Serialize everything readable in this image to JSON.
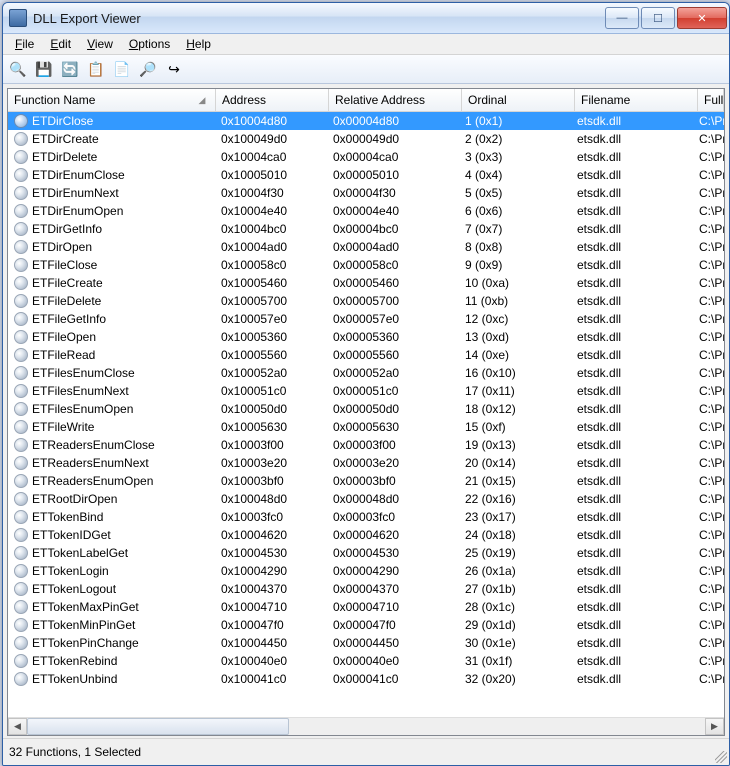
{
  "window": {
    "title": "DLL Export Viewer"
  },
  "menu": {
    "file": "File",
    "edit": "Edit",
    "view": "View",
    "options": "Options",
    "help": "Help"
  },
  "toolbar_icons": {
    "find": "🔍",
    "save": "💾",
    "refresh": "🔄",
    "copy": "📋",
    "props": "📄",
    "html_report": "🔎",
    "exit": "↪"
  },
  "columns": {
    "function_name": "Function Name",
    "address": "Address",
    "relative_address": "Relative Address",
    "ordinal": "Ordinal",
    "filename": "Filename",
    "full_path": "Full Path"
  },
  "status": "32 Functions, 1 Selected",
  "rows": [
    {
      "fn": "ETDirClose",
      "ad": "0x10004d80",
      "ra": "0x00004d80",
      "or": "1 (0x1)",
      "fi": "etsdk.dll",
      "fp": "C:\\Program Files",
      "sel": true
    },
    {
      "fn": "ETDirCreate",
      "ad": "0x100049d0",
      "ra": "0x000049d0",
      "or": "2 (0x2)",
      "fi": "etsdk.dll",
      "fp": "C:\\Program Files"
    },
    {
      "fn": "ETDirDelete",
      "ad": "0x10004ca0",
      "ra": "0x00004ca0",
      "or": "3 (0x3)",
      "fi": "etsdk.dll",
      "fp": "C:\\Program Files"
    },
    {
      "fn": "ETDirEnumClose",
      "ad": "0x10005010",
      "ra": "0x00005010",
      "or": "4 (0x4)",
      "fi": "etsdk.dll",
      "fp": "C:\\Program Files"
    },
    {
      "fn": "ETDirEnumNext",
      "ad": "0x10004f30",
      "ra": "0x00004f30",
      "or": "5 (0x5)",
      "fi": "etsdk.dll",
      "fp": "C:\\Program Files"
    },
    {
      "fn": "ETDirEnumOpen",
      "ad": "0x10004e40",
      "ra": "0x00004e40",
      "or": "6 (0x6)",
      "fi": "etsdk.dll",
      "fp": "C:\\Program Files"
    },
    {
      "fn": "ETDirGetInfo",
      "ad": "0x10004bc0",
      "ra": "0x00004bc0",
      "or": "7 (0x7)",
      "fi": "etsdk.dll",
      "fp": "C:\\Program Files"
    },
    {
      "fn": "ETDirOpen",
      "ad": "0x10004ad0",
      "ra": "0x00004ad0",
      "or": "8 (0x8)",
      "fi": "etsdk.dll",
      "fp": "C:\\Program Files"
    },
    {
      "fn": "ETFileClose",
      "ad": "0x100058c0",
      "ra": "0x000058c0",
      "or": "9 (0x9)",
      "fi": "etsdk.dll",
      "fp": "C:\\Program Files"
    },
    {
      "fn": "ETFileCreate",
      "ad": "0x10005460",
      "ra": "0x00005460",
      "or": "10 (0xa)",
      "fi": "etsdk.dll",
      "fp": "C:\\Program Files"
    },
    {
      "fn": "ETFileDelete",
      "ad": "0x10005700",
      "ra": "0x00005700",
      "or": "11 (0xb)",
      "fi": "etsdk.dll",
      "fp": "C:\\Program Files"
    },
    {
      "fn": "ETFileGetInfo",
      "ad": "0x100057e0",
      "ra": "0x000057e0",
      "or": "12 (0xc)",
      "fi": "etsdk.dll",
      "fp": "C:\\Program Files"
    },
    {
      "fn": "ETFileOpen",
      "ad": "0x10005360",
      "ra": "0x00005360",
      "or": "13 (0xd)",
      "fi": "etsdk.dll",
      "fp": "C:\\Program Files"
    },
    {
      "fn": "ETFileRead",
      "ad": "0x10005560",
      "ra": "0x00005560",
      "or": "14 (0xe)",
      "fi": "etsdk.dll",
      "fp": "C:\\Program Files"
    },
    {
      "fn": "ETFilesEnumClose",
      "ad": "0x100052a0",
      "ra": "0x000052a0",
      "or": "16 (0x10)",
      "fi": "etsdk.dll",
      "fp": "C:\\Program Files"
    },
    {
      "fn": "ETFilesEnumNext",
      "ad": "0x100051c0",
      "ra": "0x000051c0",
      "or": "17 (0x11)",
      "fi": "etsdk.dll",
      "fp": "C:\\Program Files"
    },
    {
      "fn": "ETFilesEnumOpen",
      "ad": "0x100050d0",
      "ra": "0x000050d0",
      "or": "18 (0x12)",
      "fi": "etsdk.dll",
      "fp": "C:\\Program Files"
    },
    {
      "fn": "ETFileWrite",
      "ad": "0x10005630",
      "ra": "0x00005630",
      "or": "15 (0xf)",
      "fi": "etsdk.dll",
      "fp": "C:\\Program Files"
    },
    {
      "fn": "ETReadersEnumClose",
      "ad": "0x10003f00",
      "ra": "0x00003f00",
      "or": "19 (0x13)",
      "fi": "etsdk.dll",
      "fp": "C:\\Program Files"
    },
    {
      "fn": "ETReadersEnumNext",
      "ad": "0x10003e20",
      "ra": "0x00003e20",
      "or": "20 (0x14)",
      "fi": "etsdk.dll",
      "fp": "C:\\Program Files"
    },
    {
      "fn": "ETReadersEnumOpen",
      "ad": "0x10003bf0",
      "ra": "0x00003bf0",
      "or": "21 (0x15)",
      "fi": "etsdk.dll",
      "fp": "C:\\Program Files"
    },
    {
      "fn": "ETRootDirOpen",
      "ad": "0x100048d0",
      "ra": "0x000048d0",
      "or": "22 (0x16)",
      "fi": "etsdk.dll",
      "fp": "C:\\Program Files"
    },
    {
      "fn": "ETTokenBind",
      "ad": "0x10003fc0",
      "ra": "0x00003fc0",
      "or": "23 (0x17)",
      "fi": "etsdk.dll",
      "fp": "C:\\Program Files"
    },
    {
      "fn": "ETTokenIDGet",
      "ad": "0x10004620",
      "ra": "0x00004620",
      "or": "24 (0x18)",
      "fi": "etsdk.dll",
      "fp": "C:\\Program Files"
    },
    {
      "fn": "ETTokenLabelGet",
      "ad": "0x10004530",
      "ra": "0x00004530",
      "or": "25 (0x19)",
      "fi": "etsdk.dll",
      "fp": "C:\\Program Files"
    },
    {
      "fn": "ETTokenLogin",
      "ad": "0x10004290",
      "ra": "0x00004290",
      "or": "26 (0x1a)",
      "fi": "etsdk.dll",
      "fp": "C:\\Program Files"
    },
    {
      "fn": "ETTokenLogout",
      "ad": "0x10004370",
      "ra": "0x00004370",
      "or": "27 (0x1b)",
      "fi": "etsdk.dll",
      "fp": "C:\\Program Files"
    },
    {
      "fn": "ETTokenMaxPinGet",
      "ad": "0x10004710",
      "ra": "0x00004710",
      "or": "28 (0x1c)",
      "fi": "etsdk.dll",
      "fp": "C:\\Program Files"
    },
    {
      "fn": "ETTokenMinPinGet",
      "ad": "0x100047f0",
      "ra": "0x000047f0",
      "or": "29 (0x1d)",
      "fi": "etsdk.dll",
      "fp": "C:\\Program Files"
    },
    {
      "fn": "ETTokenPinChange",
      "ad": "0x10004450",
      "ra": "0x00004450",
      "or": "30 (0x1e)",
      "fi": "etsdk.dll",
      "fp": "C:\\Program Files"
    },
    {
      "fn": "ETTokenRebind",
      "ad": "0x100040e0",
      "ra": "0x000040e0",
      "or": "31 (0x1f)",
      "fi": "etsdk.dll",
      "fp": "C:\\Program Files"
    },
    {
      "fn": "ETTokenUnbind",
      "ad": "0x100041c0",
      "ra": "0x000041c0",
      "or": "32 (0x20)",
      "fi": "etsdk.dll",
      "fp": "C:\\Program Files"
    }
  ]
}
